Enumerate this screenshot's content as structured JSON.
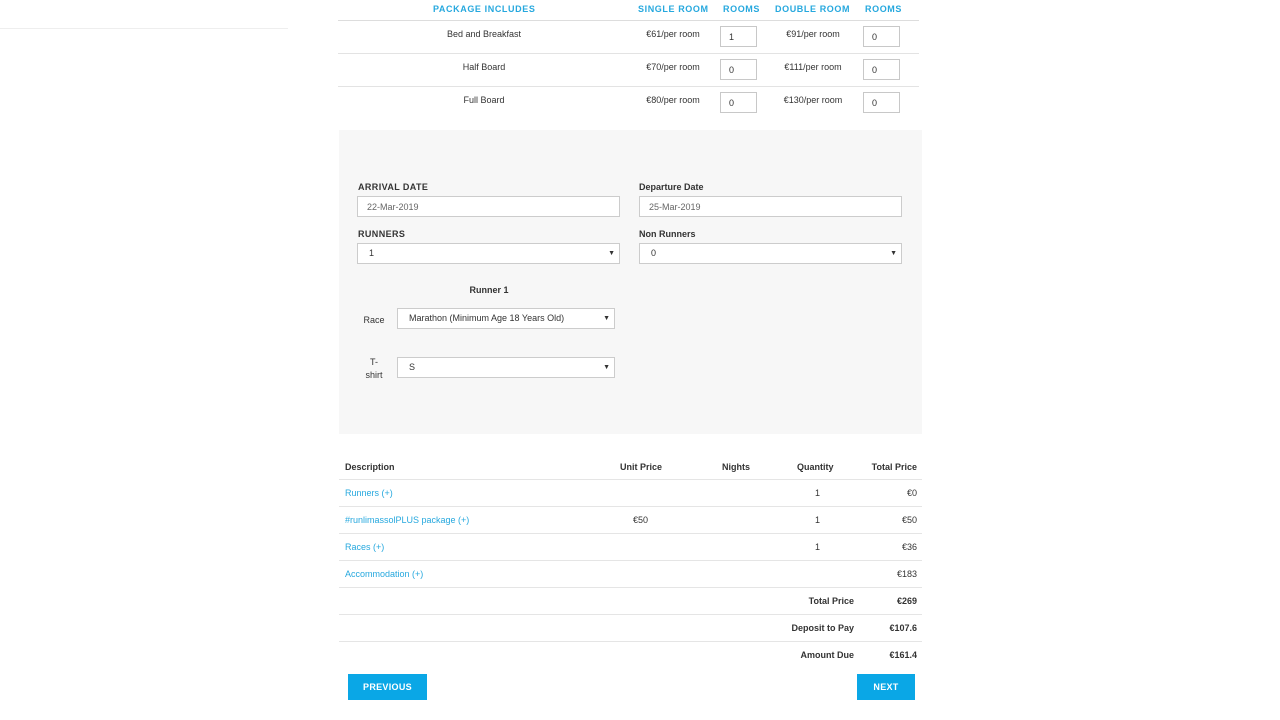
{
  "packages": {
    "headers": {
      "package_includes": "PACKAGE INCLUDES",
      "single_room": "SINGLE ROOM",
      "rooms_single": "ROOMS",
      "double_room": "DOUBLE ROOM",
      "rooms_double": "ROOMS"
    },
    "rows": [
      {
        "name": "Bed and Breakfast",
        "single_price": "€61/per room",
        "single_rooms": "1",
        "double_price": "€91/per room",
        "double_rooms": "0"
      },
      {
        "name": "Half Board",
        "single_price": "€70/per room",
        "single_rooms": "0",
        "double_price": "€111/per room",
        "double_rooms": "0"
      },
      {
        "name": "Full Board",
        "single_price": "€80/per room",
        "single_rooms": "0",
        "double_price": "€130/per room",
        "double_rooms": "0"
      }
    ]
  },
  "booking": {
    "arrival_label": "ARRIVAL DATE",
    "arrival_value": "22-Mar-2019",
    "departure_label": "Departure Date",
    "departure_value": "25-Mar-2019",
    "runners_label": "RUNNERS",
    "runners_value": "1",
    "non_runners_label": "Non Runners",
    "non_runners_value": "0",
    "runner_title": "Runner 1",
    "race_label": "Race",
    "race_value": "Marathon (Minimum Age 18 Years Old)",
    "tshirt_label_1": "T-",
    "tshirt_label_2": "shirt",
    "tshirt_value": "S",
    "caret": "▼"
  },
  "summary": {
    "headers": {
      "description": "Description",
      "unit_price": "Unit Price",
      "nights": "Nights",
      "quantity": "Quantity",
      "total_price": "Total Price"
    },
    "rows": [
      {
        "description": "Runners (+)",
        "unit_price": "",
        "nights": "",
        "quantity": "1",
        "total": "€0"
      },
      {
        "description": "#runlimassolPLUS package (+)",
        "unit_price": "€50",
        "nights": "",
        "quantity": "1",
        "total": "€50"
      },
      {
        "description": "Races (+)",
        "unit_price": "",
        "nights": "",
        "quantity": "1",
        "total": "€36"
      },
      {
        "description": "Accommodation (+)",
        "unit_price": "",
        "nights": "",
        "quantity": "",
        "total": "€183"
      }
    ],
    "totals": [
      {
        "label": "Total Price",
        "value": "€269"
      },
      {
        "label": "Deposit to Pay",
        "value": "€107.6"
      },
      {
        "label": "Amount Due",
        "value": "€161.4"
      }
    ]
  },
  "buttons": {
    "previous": "PREVIOUS",
    "next": "NEXT"
  },
  "colors": {
    "accent": "#26a8de",
    "button": "#0aa7e6",
    "panel_bg": "#f7f7f7"
  }
}
